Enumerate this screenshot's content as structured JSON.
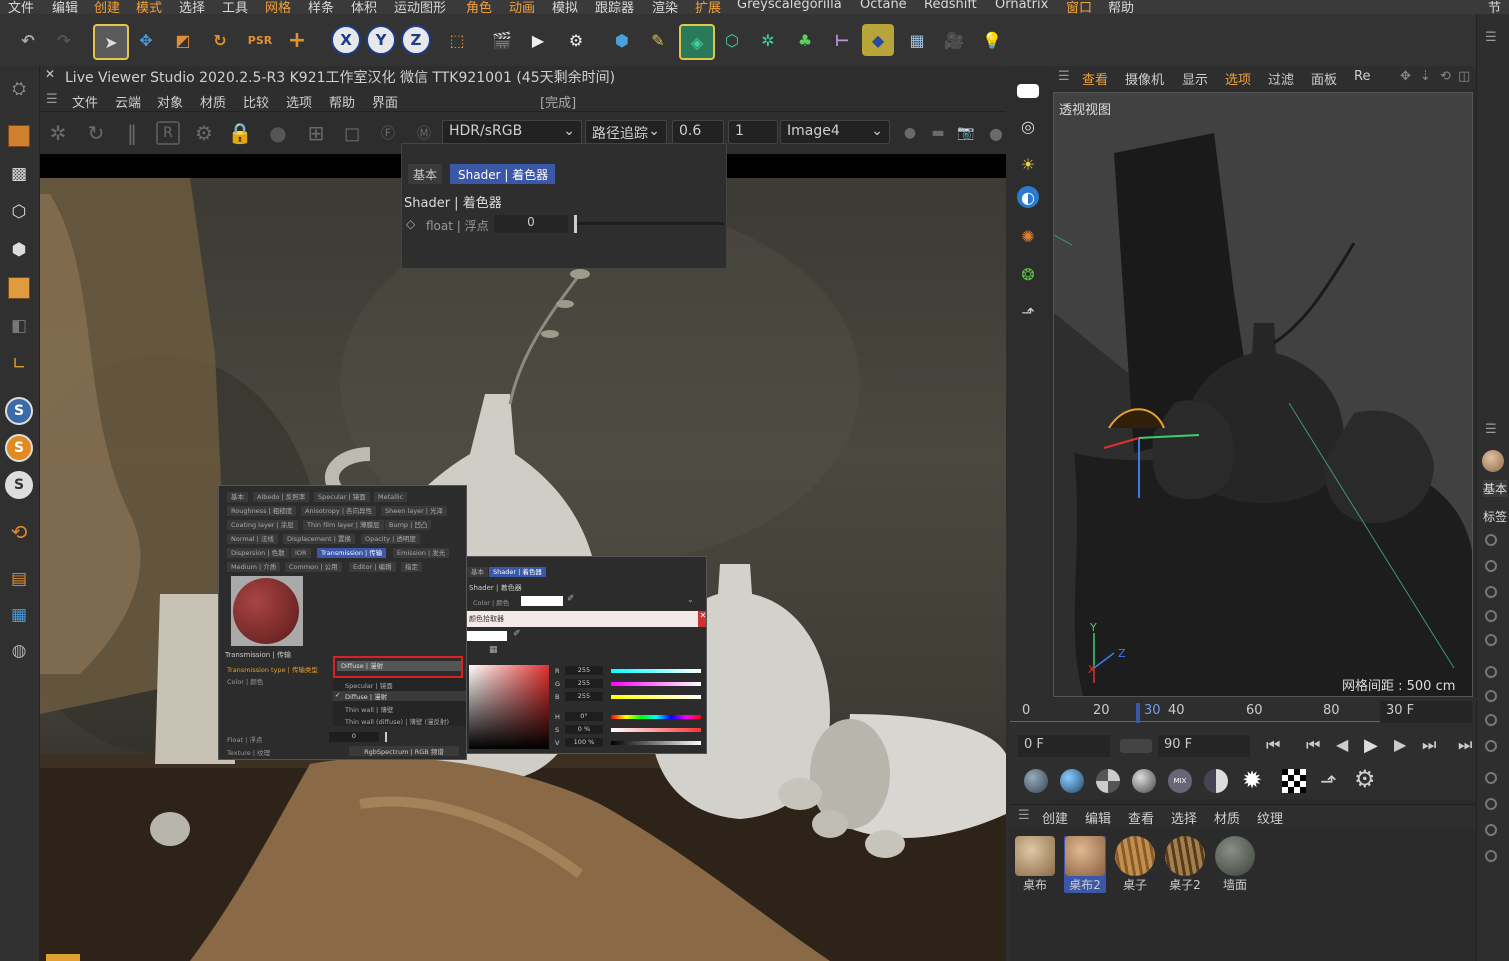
{
  "menubar": {
    "items": [
      "文件",
      "编辑",
      "创建",
      "模式",
      "选择",
      "工具",
      "网格",
      "样条",
      "体积",
      "运动图形",
      "角色",
      "动画",
      "模拟",
      "跟踪器",
      "渲染",
      "扩展",
      "Greyscalegorilla",
      "Octane",
      "Redshift",
      "Ornatrix",
      "窗口",
      "帮助"
    ],
    "right_label": "节"
  },
  "liveviewer": {
    "title": "Live Viewer Studio 2020.2.5-R3  K921工作室汉化  微信  TTK921001     (45天剩余时间)",
    "menu": [
      "文件",
      "云端",
      "对象",
      "材质",
      "比较",
      "选项",
      "帮助",
      "界面"
    ],
    "status": "[完成]",
    "colorspace": "HDR/sRGB",
    "kernel": "路径追踪",
    "value1": "0.6",
    "value2": "1",
    "image": "Image4"
  },
  "shader_popup": {
    "tab_basic": "基本",
    "tab_shader": "Shader | 着色器",
    "heading": "Shader | 着色器",
    "field_label": "float | 浮点",
    "field_value": "0"
  },
  "material_panel": {
    "tabs_row1": [
      "基本",
      "Albedo | 反照率",
      "Specular | 镜面",
      "Metallic"
    ],
    "tabs_row2": [
      "Roughness | 粗糙度",
      "Anisotropy | 各向异性",
      "Sheen layer | 光泽"
    ],
    "tabs_row3": [
      "Coating layer | 涂层",
      "Thin film layer | 薄膜层",
      "Bump | 凹凸"
    ],
    "tabs_row4": [
      "Normal | 法线",
      "Displacement | 置换",
      "Opacity | 透明度"
    ],
    "tabs_row5": [
      "Dispersion | 色散",
      "IOR",
      "Transmission | 传输",
      "Emission | 发光"
    ],
    "tabs_row6": [
      "Medium | 介质",
      "Common | 公用",
      "Editor | 编辑",
      "指定"
    ],
    "section": "Transmission | 传输",
    "trans_type_label": "Transmission type | 传输类型",
    "color_label": "Color | 颜色",
    "float_label": "Float | 浮点",
    "float_value": "0",
    "texture_label": "Texture | 纹理",
    "texture_value": "RgbSpectrum | RGB 频谱",
    "options": [
      "Diffuse | 漫射",
      "Specular | 镜面",
      "Diffuse | 漫射",
      "Thin wall | 薄壁",
      "Thin wall (diffuse) | 薄壁 (漫反射)"
    ]
  },
  "color_panel": {
    "tab1": "基本",
    "tab2": "Shader | 着色器",
    "heading": "Shader | 着色器",
    "color_label": "Color | 颜色",
    "picker_label": "颜色拾取器",
    "rows": [
      {
        "k": "R",
        "v": "255"
      },
      {
        "k": "G",
        "v": "255"
      },
      {
        "k": "B",
        "v": "255"
      },
      {
        "k": "H",
        "v": "0°"
      },
      {
        "k": "S",
        "v": "0 %"
      },
      {
        "k": "V",
        "v": "100 %"
      }
    ]
  },
  "viewport": {
    "menu": [
      "查看",
      "摄像机",
      "显示",
      "选项",
      "过滤",
      "面板",
      "Re"
    ],
    "title": "透视视图",
    "grid_spacing": "网格间距 : 500 cm"
  },
  "timeline": {
    "ticks": [
      "0",
      "20",
      "30",
      "40",
      "60",
      "80"
    ],
    "current": "30",
    "end_frame": "30 F",
    "start": "0 F",
    "max": "90 F"
  },
  "material_manager": {
    "tabs": [
      "创建",
      "编辑",
      "查看",
      "选择",
      "材质",
      "纹理"
    ],
    "materials": [
      {
        "name": "桌布",
        "color": "#c9a985"
      },
      {
        "name": "桌布2",
        "color": "#c9a070"
      },
      {
        "name": "桌子",
        "color": "#a57a44"
      },
      {
        "name": "桌子2",
        "color": "#8a6a44"
      },
      {
        "name": "墙面",
        "color": "#5e635d"
      }
    ]
  },
  "far_right": {
    "labels": [
      "基本",
      "标签"
    ]
  },
  "colors": {
    "accent_orange": "#f0a13a",
    "accent_blue": "#3b57a8",
    "highlight_red": "#e02020"
  }
}
